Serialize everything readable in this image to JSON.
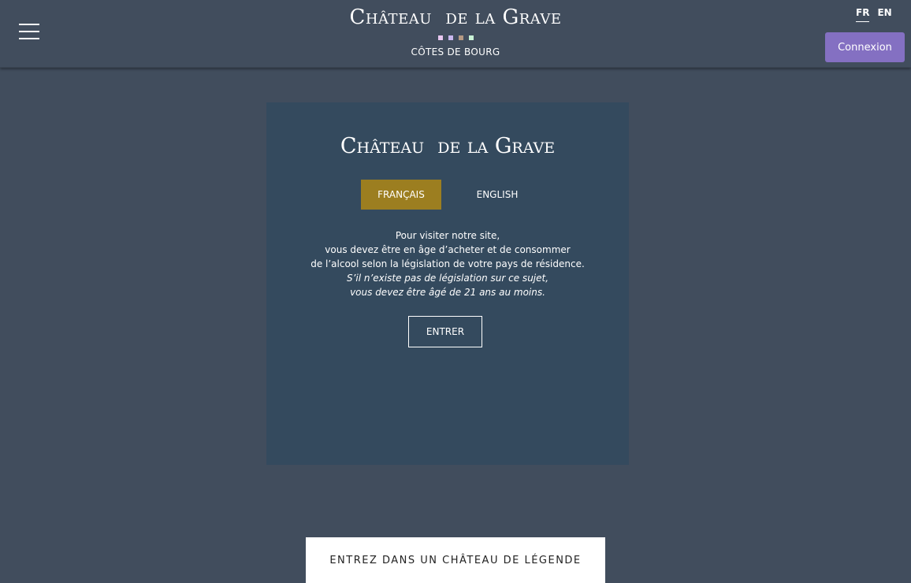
{
  "header": {
    "brand_title": "Château  de la Grave",
    "brand_subtitle": "CÔTES DE BOURG",
    "squares": [
      "#e8c7f0",
      "#c9b8ee",
      "#b59a84",
      "#c9f2d6"
    ],
    "lang": {
      "fr": "FR",
      "en": "EN",
      "active": "FR"
    },
    "login_label": "Connexion",
    "menu_icon": "hamburger-icon"
  },
  "age_gate": {
    "title": "Château  de la Grave",
    "lang_buttons": {
      "fr": "FRANÇAIS",
      "en": "ENGLISH"
    },
    "lines": [
      "Pour visiter notre site,",
      "vous devez être en âge d’acheter et de consommer",
      "de l’alcool selon la législation de votre pays de résidence."
    ],
    "italic_lines": [
      "S’il n’existe pas de législation sur ce sujet,",
      "vous devez être âgé de 21 ans au moins."
    ],
    "enter_label": "ENTRER"
  },
  "banner": {
    "text": "ENTREZ DANS UN CHÂTEAU DE LÉGENDE"
  },
  "colors": {
    "page_bg": "#414d5d",
    "panel_bg": "#344a5e",
    "accent_gold": "#9c7e20",
    "login_purple": "#8470c2"
  }
}
